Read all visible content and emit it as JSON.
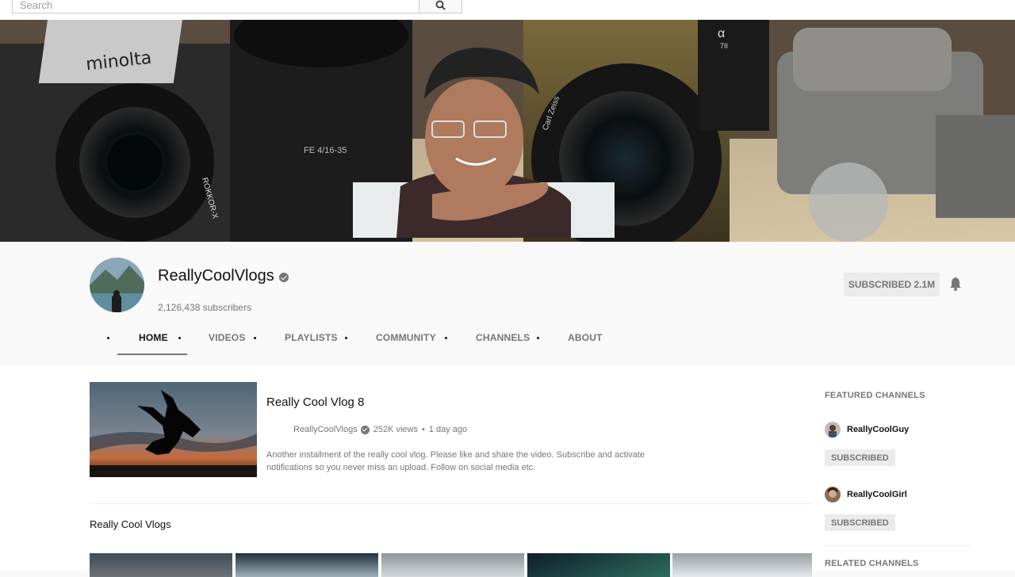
{
  "search": {
    "placeholder": "Search",
    "icon": "search-icon"
  },
  "channel": {
    "name": "ReallyCoolVlogs",
    "subscribers": "2,126,438 subscribers",
    "subscribe_label": "SUBSCRIBED 2.1M",
    "bell_icon": "bell-icon"
  },
  "banner": {
    "camera_brand": "minolta",
    "lens_text_1": "FE 4/16-35",
    "lens_text_2": "ROKKOR-X",
    "lens_text_3": "Carl Zeiss",
    "alpha_text": "α",
    "alpha_model": "7II"
  },
  "tabs": [
    {
      "label": "HOME",
      "active": true
    },
    {
      "label": "VIDEOS",
      "active": false
    },
    {
      "label": "PLAYLISTS",
      "active": false
    },
    {
      "label": "COMMUNITY",
      "active": false
    },
    {
      "label": "CHANNELS",
      "active": false
    },
    {
      "label": "ABOUT",
      "active": false
    }
  ],
  "featured_video": {
    "title": "Really Cool Vlog 8",
    "channel": "ReallyCoolVlogs",
    "views": "252K views",
    "age": "1 day ago",
    "separator": "•",
    "description": "Another installment of the really cool vlog. Please like and share the video. Subscribe and activate notifications so you never miss an upload. Follow on social media etc."
  },
  "shelf": {
    "title": "Really Cool Vlogs"
  },
  "sidebar": {
    "featured_heading": "FEATURED CHANNELS",
    "featured": [
      {
        "name": "ReallyCoolGuy",
        "subscribe_label": "SUBSCRIBED"
      },
      {
        "name": "ReallyCoolGirl",
        "subscribe_label": "SUBSCRIBED"
      }
    ],
    "related_heading": "RELATED CHANNELS"
  },
  "colors": {
    "text": "#111111",
    "muted": "#767676",
    "button_bg": "#ebebeb",
    "page_bg": "#f9f9f9"
  }
}
